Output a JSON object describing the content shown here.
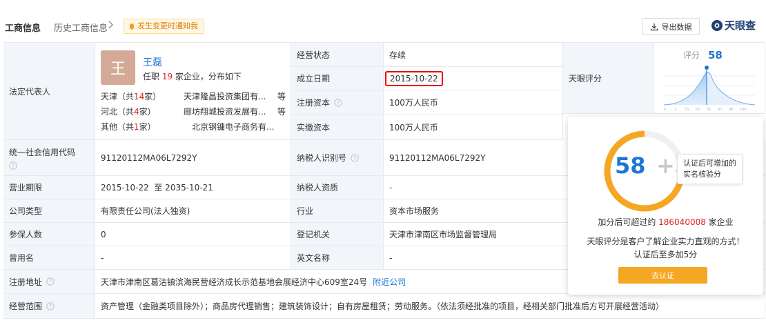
{
  "header": {
    "title": "工商信息",
    "history": "历史工商信息",
    "notify": "发生变更时通知我",
    "export": "导出数据",
    "logo": "天眼查"
  },
  "legal_rep": {
    "label": "法定代表人",
    "avatar_char": "王",
    "name": "王磊",
    "sub_prefix": "任职 ",
    "sub_count": "19",
    "sub_suffix": " 家企业，分布如下",
    "regions": [
      {
        "region_prefix": "天津（共",
        "count": "14",
        "region_suffix": "家）",
        "company": "天津隆昌投资集团有...",
        "deng": "等"
      },
      {
        "region_prefix": "河北（共",
        "count": "4",
        "region_suffix": "家）",
        "company": "廊坊翔城投资发展有...",
        "deng": "等"
      },
      {
        "region_prefix": "其他（共",
        "count": "1",
        "region_suffix": "家）",
        "company": "北京钢镛电子商务有...",
        "deng": ""
      }
    ]
  },
  "fields": {
    "status_label": "经营状态",
    "status_value": "存续",
    "founded_label": "成立日期",
    "founded_value": "2015-10-22",
    "reg_capital_label": "注册资本",
    "reg_capital_value": "100万人民币",
    "paid_capital_label": "实缴资本",
    "paid_capital_value": "100万人民币",
    "credit_code_label": "统一社会信用代码",
    "credit_code_value": "91120112MA06L7292Y",
    "taxpayer_id_label": "纳税人识别号",
    "taxpayer_id_value": "91120112MA06L7292Y",
    "term_label": "营业期限",
    "term_value": "2015-10-22  至 2035-10-21",
    "tax_qual_label": "纳税人资质",
    "tax_qual_value": "-",
    "company_type_label": "公司类型",
    "company_type_value": "有限责任公司(法人独资)",
    "industry_label": "行业",
    "industry_value": "资本市场服务",
    "insured_label": "参保人数",
    "insured_value": "0",
    "reg_authority_label": "登记机关",
    "reg_authority_value": "天津市津南区市场监督管理局",
    "former_name_label": "曾用名",
    "former_name_value": "-",
    "english_name_label": "英文名称",
    "english_name_value": "-",
    "address_label": "注册地址",
    "address_value": "天津市津南区葛沽镇滨海民营经济成长示范基地会展经济中心609室24号",
    "address_link": "附近公司",
    "scope_label": "经营范围",
    "scope_value": "资产管理（金融类项目除外）；商品房代理销售；建筑装饰设计；自有房屋租赁；劳动服务。（依法须经批准的项目，经相关部门批准后方可开展经营活动）"
  },
  "score": {
    "label": "天眼评分",
    "title": "评分",
    "value": "58",
    "axis": [
      "0",
      "1",
      "15",
      "50",
      "85",
      "97",
      "98",
      "100"
    ]
  },
  "popup": {
    "score": "58",
    "plus": "+5",
    "tip_line1": "认证后可增加的",
    "tip_line2": "实名核验分",
    "line1_prefix": "加分后可超过约 ",
    "line1_num": "186040008",
    "line1_suffix": " 家企业",
    "line2": "天眼评分是客户了解企业实力直观的方式！",
    "line3": "认证后至多加5分",
    "button": "去认证"
  },
  "colors": {
    "accent_blue": "#1c76d6",
    "label_bg": "#f2f6fb",
    "highlight_red": "#e50000",
    "button_orange": "#f5a623"
  }
}
